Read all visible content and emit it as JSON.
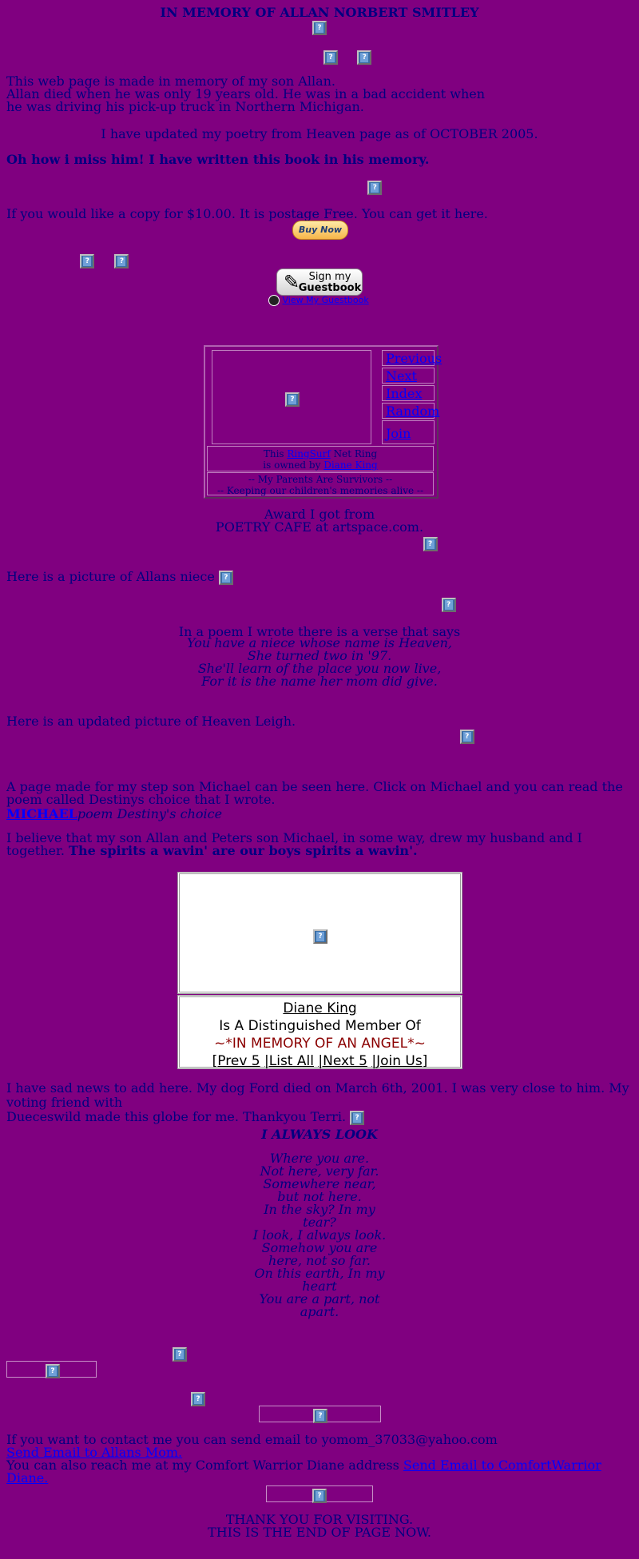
{
  "header": {
    "title": "IN MEMORY OF ALLAN NORBERT SMITLEY"
  },
  "intro": {
    "line1": "This web page is made in memory of my son Allan.",
    "line2": "Allan died when he was only 19 years old. He was in a bad accident when",
    "line3": "he was driving his pick-up truck in Northern Michigan."
  },
  "poetry_update": "I have updated my poetry from Heaven page as of OCTOBER 2005.",
  "book": {
    "heading": "Oh how i miss him! I have written this book in his memory.",
    "offer": "If you would like a copy for $10.00. It is postage Free. You can get it here.",
    "buy_label": "Buy Now"
  },
  "guestbook": {
    "line1": "Sign my",
    "line2": "Guestbook",
    "view_label": "View My Guestbook"
  },
  "webring": {
    "nav": [
      "Previous",
      "Next",
      "Index",
      "Random",
      "Join"
    ],
    "owner_prefix1": "This ",
    "owner_link1": "RingSurf",
    "owner_suffix1": " Net Ring",
    "owner_prefix2": "is owned by ",
    "owner_link2": "Diane King",
    "name_line1": "-- My Parents Are Survivors --",
    "name_line2": "-- Keeping our children's memories alive --"
  },
  "award": {
    "line1": "Award I got from",
    "line2": "POETRY CAFE at artspace.com."
  },
  "niece": {
    "caption": "Here is a picture of Allans niece",
    "poem_intro": "In a poem I wrote there is a verse that says",
    "verse": [
      "You have a niece whose name is Heaven,",
      "She turned two in '97.",
      "She'll learn of the place you now live,",
      "For it is the name her mom did give."
    ],
    "updated_caption": "Here is an updated picture of Heaven Leigh."
  },
  "michael": {
    "text": "A page made for my step son Michael can be seen here. Click on Michael and you can read the poem called Destinys choice that I wrote.",
    "link": "MICHAEL",
    "poem_label": "poem Destiny's choice"
  },
  "belief": {
    "text": "I believe that my son Allan and Peters son Michael, in some way, drew my husband and I together. ",
    "bold": "The spirits a wavin' are our boys spirits a wavin'."
  },
  "member": {
    "name": "Diane King",
    "line": "Is A Distinguished Member Of",
    "ring": "~*IN MEMORY OF AN ANGEL*~",
    "nav": [
      "[Prev 5",
      "|List All",
      "|Next 5",
      "|Join Us]"
    ]
  },
  "dog": {
    "line1": "I have sad news to add here. My dog Ford died on March 6th, 2001. I was very close to him. My voting friend with",
    "line2": "Dueceswild made this globe for me. Thankyou Terri."
  },
  "poem": {
    "title": "I ALWAYS LOOK",
    "lines": [
      "Where you are.",
      "Not here, very far.",
      "Somewhere near,",
      "but not here.",
      "In the sky? In my",
      "tear?",
      "I look, I always look.",
      "Somehow you are",
      "here, not so far.",
      "On this earth, In my",
      "heart",
      "You are a part, not",
      "apart."
    ]
  },
  "contact": {
    "email_line": "If you want to contact me you can send email to yomom_37033@yahoo.com",
    "email_link": "Send Email to Allans Mom.",
    "cw_line": "You can also reach me at my Comfort Warrior Diane address ",
    "cw_link": "Send Email to ComfortWarrior Diane."
  },
  "footer": {
    "line1": "THANK YOU FOR VISITING.",
    "line2": "THIS IS THE END OF PAGE NOW."
  }
}
